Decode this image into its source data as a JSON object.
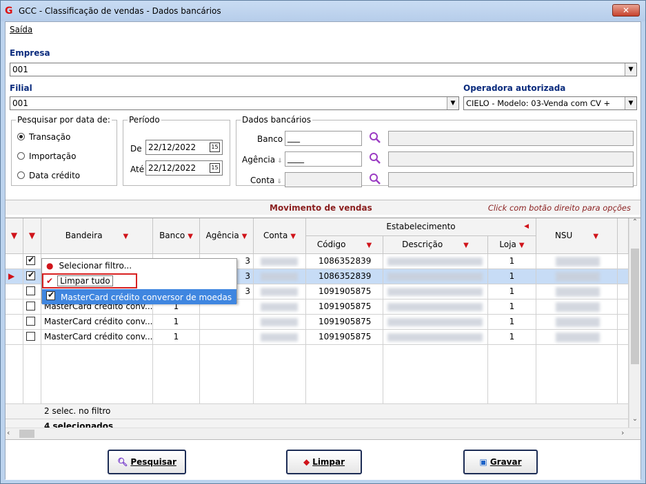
{
  "window": {
    "title": "GCC - Classificação de vendas - Dados bancários",
    "close_glyph": "✕"
  },
  "menu": {
    "item1": "Saída"
  },
  "empresa": {
    "label": "Empresa",
    "value": "001"
  },
  "filial": {
    "label": "Filial",
    "value": "001"
  },
  "operadora": {
    "label": "Operadora autorizada",
    "value": "CIELO - Modelo: 03-Venda com CV +"
  },
  "pesquisar": {
    "label": "Pesquisar por data de:",
    "options": [
      "Transação",
      "Importação",
      "Data crédito"
    ],
    "selected": "Transação"
  },
  "periodo": {
    "label": "Período",
    "de_label": "De",
    "de_value": "22/12/2022",
    "ate_label": "Até",
    "ate_value": "22/12/2022"
  },
  "dados": {
    "label": "Dados bancários",
    "banco_label": "Banco",
    "banco_value": "___",
    "agencia_label": "Agência",
    "agencia_value": "____",
    "conta_label": "Conta"
  },
  "section": {
    "title": "Movimento de vendas",
    "hint": "Click com botão direito para opções"
  },
  "grid": {
    "columns": {
      "bandeira": "Bandeira",
      "banco": "Banco",
      "agencia": "Agência",
      "conta": "Conta",
      "estabelecimento": "Estabelecimento",
      "codigo": "Código",
      "descricao": "Descrição",
      "loja": "Loja",
      "nsu": "NSU"
    },
    "rows": [
      {
        "checked": true,
        "bandeira": "",
        "banco": "",
        "agencia_partial": "3",
        "codigo": "1086352839",
        "loja": "1"
      },
      {
        "checked": true,
        "bandeira": "",
        "banco": "",
        "agencia_partial": "3",
        "codigo": "1086352839",
        "loja": "1"
      },
      {
        "checked": false,
        "bandeira": "",
        "banco": "",
        "agencia_partial": "3",
        "codigo": "1091905875",
        "loja": "1"
      },
      {
        "checked": false,
        "bandeira": "MasterCard crédito conv...",
        "banco": "1",
        "agencia_partial": "",
        "codigo": "1091905875",
        "loja": "1"
      },
      {
        "checked": false,
        "bandeira": "MasterCard crédito conv...",
        "banco": "1",
        "agencia_partial": "",
        "codigo": "1091905875",
        "loja": "1"
      },
      {
        "checked": false,
        "bandeira": "MasterCard crédito conv...",
        "banco": "1",
        "agencia_partial": "",
        "codigo": "1091905875",
        "loja": "1"
      }
    ],
    "summary1": "2 selec. no filtro",
    "summary2": "4 selecionados"
  },
  "popup": {
    "item1": "Selecionar filtro...",
    "item2": "Limpar tudo",
    "item3": "MasterCard crédito conversor de moedas"
  },
  "buttons": {
    "pesquisar": "Pesquisar",
    "limpar": "Limpar",
    "gravar": "Gravar"
  },
  "colors": {
    "accent": "#0a2b7d",
    "section_text": "#8a1e1e",
    "filter_red": "#d0141b",
    "selection": "#3f86e0"
  }
}
